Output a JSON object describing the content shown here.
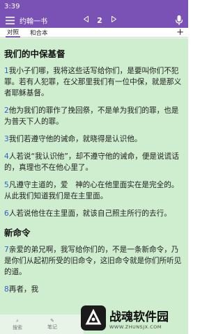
{
  "status_bar": {
    "time": "3:39"
  },
  "app_bar": {
    "book": "约翰一书",
    "prev_icon": "triangle-left-icon",
    "chapter": "2",
    "next_icon": "triangle-right-icon",
    "colors": {
      "primary": "#7a51b5"
    }
  },
  "tabs": [
    {
      "label": "对照"
    },
    {
      "label": "和合本"
    }
  ],
  "plus_label": "+",
  "sections": [
    {
      "title": "我们的中保基督",
      "verses": [
        {
          "num": "1",
          "text": "我小子们哪，我将这些话写给你们，是要叫你们不犯罪。若有人犯罪，在父那里我们有一位中保，就是那义者耶稣基督。"
        },
        {
          "num": "2",
          "text": "他为我们的罪作了挽回祭，不是单为我们的罪，也是为普天下人的罪。"
        },
        {
          "num": "3",
          "text": "我们若遵守他的诫命，就晓得是认识他。"
        },
        {
          "num": "4",
          "text": "人若说“我认识他”，却不遵守他的诫命，便是说谎话的，真理也不在他心里了。"
        },
        {
          "num": "5",
          "text": "凡遵守主道的，爱　神的心在他里面实在是完全的。从此我们知道我们是在主里面。"
        },
        {
          "num": "6",
          "text": "人若说他住在主里面，就该自己照主所行的去行。"
        }
      ]
    },
    {
      "title": "新命令",
      "verses": [
        {
          "num": "7",
          "text": "亲爱的弟兄啊，我写给你们的，不是一条新命令，乃是你们从起初所受的旧命令，这旧命令就是你们所听见的道。"
        },
        {
          "num": "8",
          "text": "再者，我"
        }
      ]
    }
  ],
  "bottom_nav": [
    {
      "label": "搜索",
      "icon": "search-icon"
    },
    {
      "label": "笔记",
      "icon": "note-icon"
    }
  ],
  "watermark": {
    "title": "战魂软件园",
    "url": "WWW.ZHUNSJX.COM"
  }
}
